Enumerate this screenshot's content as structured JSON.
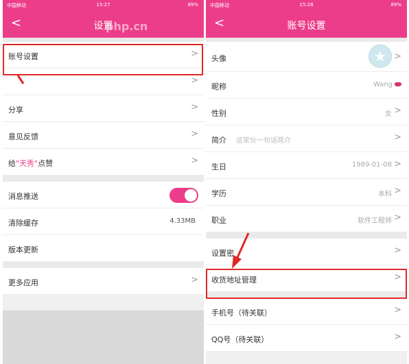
{
  "left": {
    "status": {
      "carrier": "中国移动",
      "time": "15:27",
      "right": "89%"
    },
    "nav": {
      "back": "<",
      "title": "设置"
    },
    "rows": {
      "account": "账号设置",
      "share": "分享",
      "feedback": "意见反馈",
      "rate_prefix": "给",
      "rate_name": "\"天秀\"",
      "rate_suffix": "点赞",
      "push": "消息推送",
      "cache": "清除缓存",
      "cache_size": "4.33MB",
      "version": "版本更新",
      "more_apps": "更多应用"
    }
  },
  "right": {
    "status": {
      "carrier": "中国移动",
      "time": "15:28",
      "right": "89%"
    },
    "nav": {
      "back": "<",
      "title": "账号设置"
    },
    "rows": {
      "avatar": "头像",
      "nickname": "昵称",
      "nickname_value": "Wang",
      "gender": "性别",
      "gender_value": "女",
      "intro": "简介",
      "intro_value": "这家伙一句话简介",
      "birthday": "生日",
      "birthday_value": "1989-01-08",
      "education": "学历",
      "education_value": "本科",
      "job": "职业",
      "job_value": "软件工程师",
      "settings": "设置密",
      "address": "收货地址管理",
      "phone": "手机号（待关联）",
      "qq": "QQ号（待关联）"
    }
  },
  "colors": {
    "accent": "#ec3d8a",
    "highlight": "#e02727"
  },
  "chevron": ">",
  "watermark": "php.cn"
}
